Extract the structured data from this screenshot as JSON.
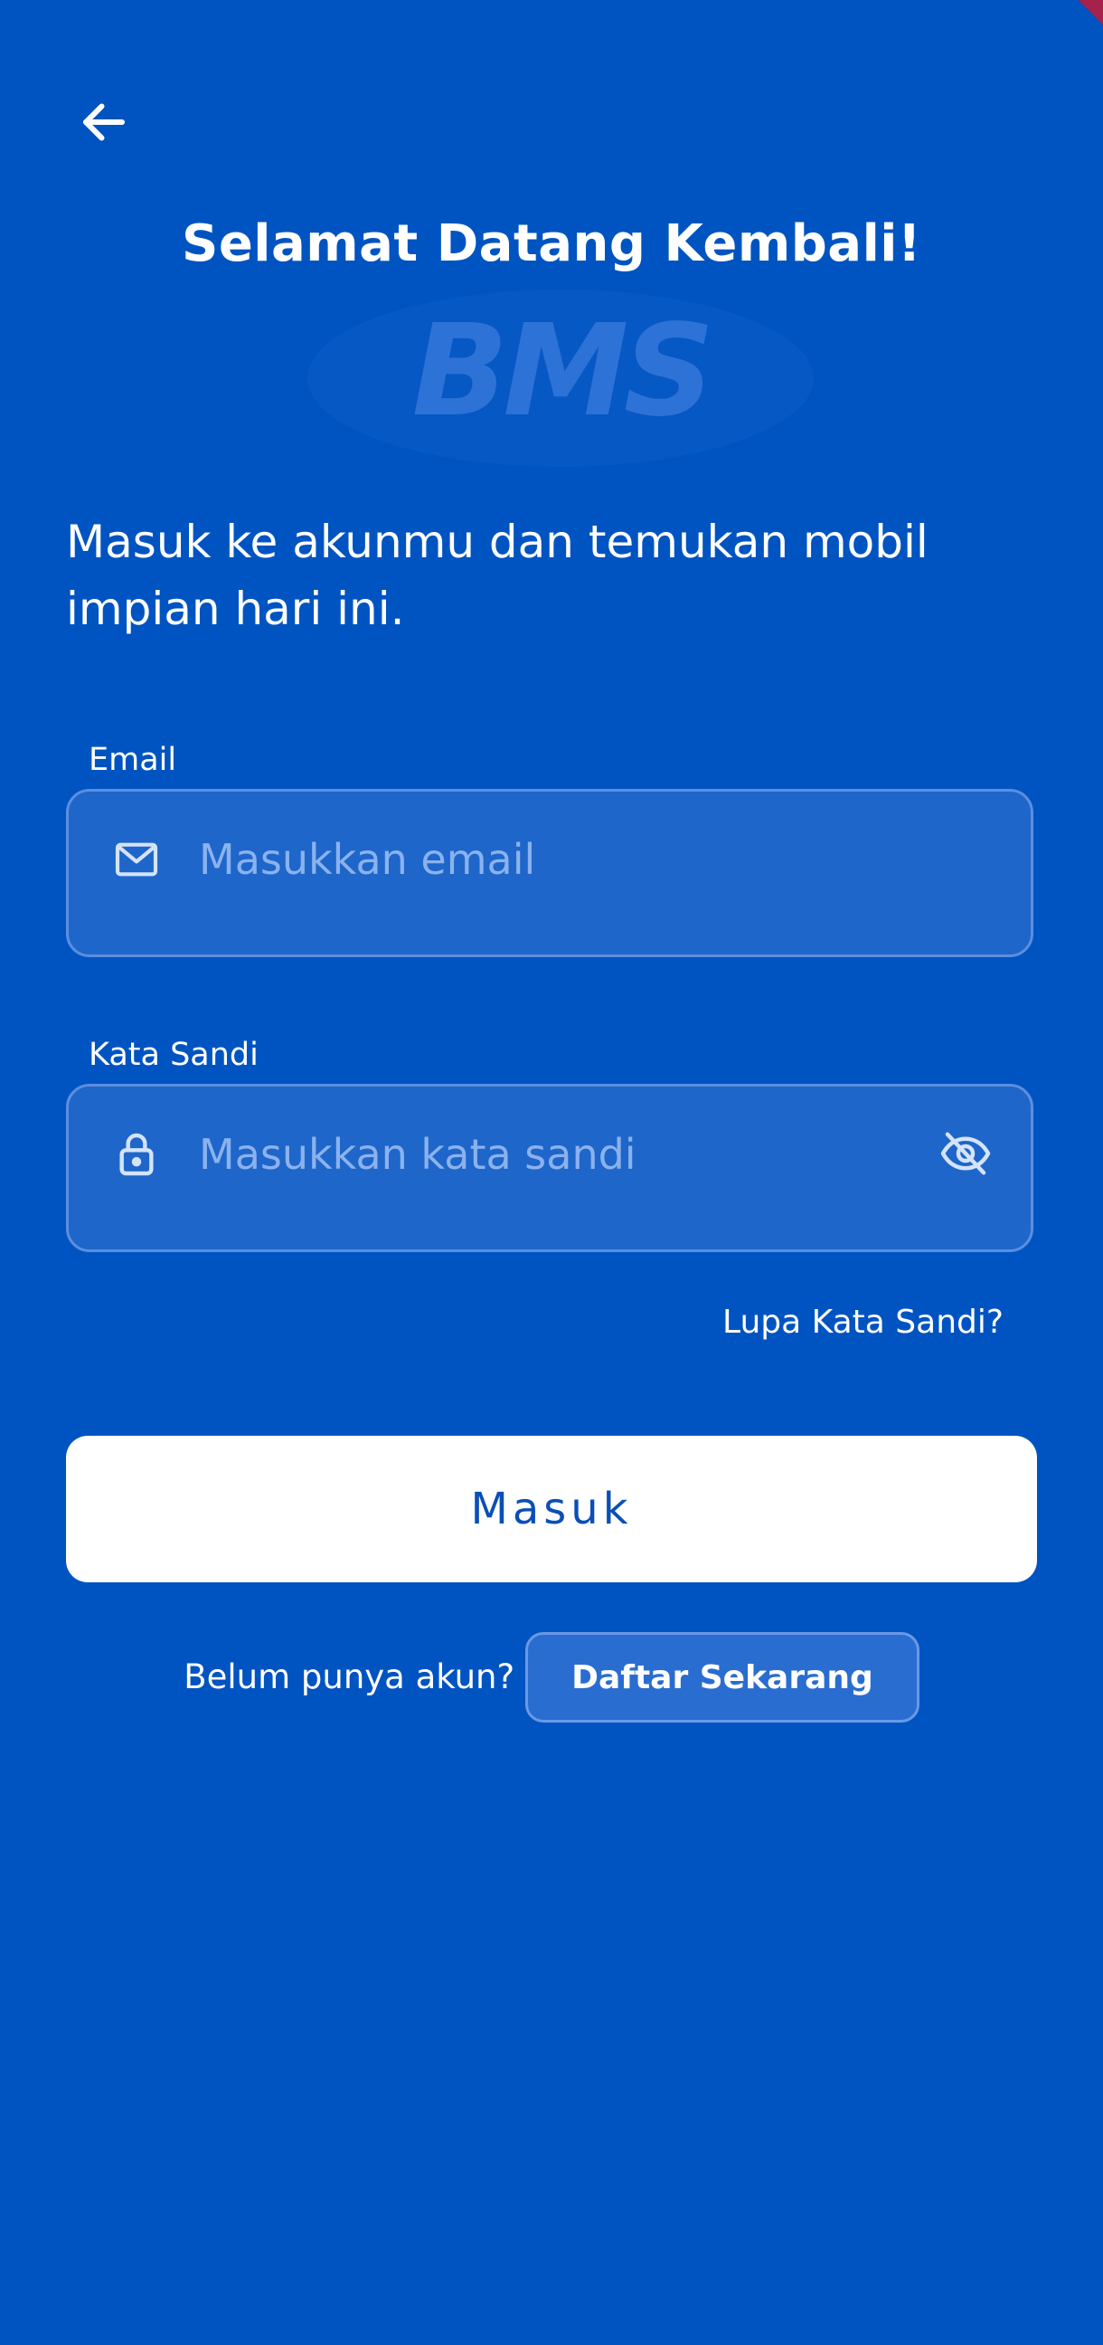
{
  "header": {
    "back_icon": "arrow-left-icon",
    "title": "Selamat Datang Kembali!"
  },
  "brand": {
    "logo_text": "BMS"
  },
  "intro": {
    "subtitle": "Masuk ke akunmu dan temukan mobil impian hari ini."
  },
  "form": {
    "email": {
      "label": "Email",
      "value": "",
      "placeholder": "Masukkan email",
      "icon": "mail-icon"
    },
    "password": {
      "label": "Kata Sandi",
      "value": "",
      "placeholder": "Masukkan kata sandi",
      "icon": "lock-icon",
      "toggle_icon": "eye-off-icon"
    },
    "forgot_label": "Lupa Kata Sandi?",
    "submit_label": "Masuk"
  },
  "signup": {
    "prompt": "Belum punya akun?",
    "button_label": "Daftar Sekarang"
  },
  "colors": {
    "background": "#0054C1",
    "input_fill": "#1E66C9",
    "input_border": "#5C8EE0",
    "placeholder": "#8BB2EE",
    "primary_button_bg": "#FFFFFF",
    "primary_button_text": "#0A4FB5",
    "corner_accent": "#A6214C"
  }
}
